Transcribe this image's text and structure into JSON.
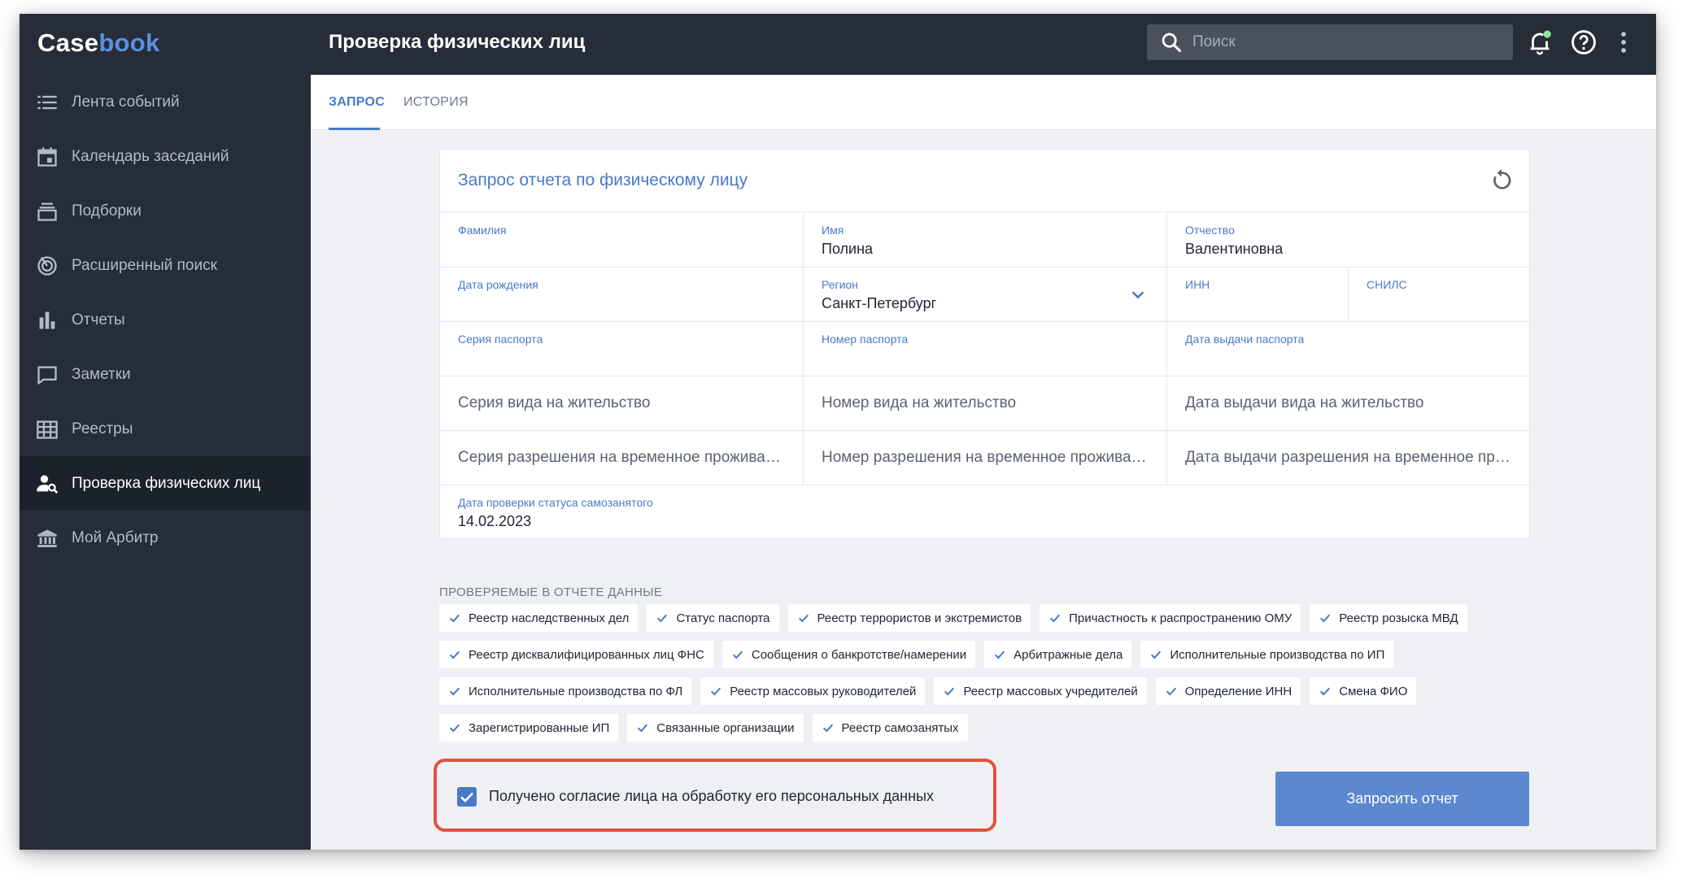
{
  "app": {
    "logo_part1": "Case",
    "logo_part2": "book",
    "page_title": "Проверка физических лиц"
  },
  "search": {
    "placeholder": "Поиск"
  },
  "sidebar": {
    "items": [
      {
        "label": "Лента событий",
        "icon": "list-icon"
      },
      {
        "label": "Календарь заседаний",
        "icon": "calendar-icon"
      },
      {
        "label": "Подборки",
        "icon": "stack-icon"
      },
      {
        "label": "Расширенный поиск",
        "icon": "target-icon"
      },
      {
        "label": "Отчеты",
        "icon": "bar-chart-icon"
      },
      {
        "label": "Заметки",
        "icon": "comment-icon"
      },
      {
        "label": "Реестры",
        "icon": "grid-icon"
      },
      {
        "label": "Проверка физических лиц",
        "icon": "person-search-icon",
        "active": true
      },
      {
        "label": "Мой Арбитр",
        "icon": "courthouse-icon"
      }
    ]
  },
  "tabs": [
    {
      "label": "ЗАПРОС",
      "active": true
    },
    {
      "label": "ИСТОРИЯ",
      "active": false
    }
  ],
  "form": {
    "title": "Запрос отчета по физическому лицу",
    "surname": {
      "label": "Фамилия",
      "value": ""
    },
    "name": {
      "label": "Имя",
      "value": "Полина"
    },
    "patronymic": {
      "label": "Отчество",
      "value": "Валентиновна"
    },
    "birth_date": {
      "label": "Дата рождения",
      "value": ""
    },
    "region": {
      "label": "Регион",
      "value": "Санкт-Петербург"
    },
    "inn": {
      "label": "ИНН",
      "value": ""
    },
    "snils": {
      "label": "СНИЛС",
      "value": ""
    },
    "passport_series": {
      "label": "Серия паспорта",
      "value": ""
    },
    "passport_number": {
      "label": "Номер паспорта",
      "value": ""
    },
    "passport_date": {
      "label": "Дата выдачи паспорта",
      "value": ""
    },
    "residence_series": {
      "placeholder": "Серия вида на жительство"
    },
    "residence_number": {
      "placeholder": "Номер вида на жительство"
    },
    "residence_date": {
      "placeholder": "Дата выдачи вида на жительство"
    },
    "temp_series": {
      "placeholder": "Серия разрешения на временное проживание"
    },
    "temp_number": {
      "placeholder": "Номер разрешения на временное проживание"
    },
    "temp_date": {
      "placeholder": "Дата выдачи разрешения на временное про..."
    },
    "self_employed": {
      "label": "Дата проверки статуса самозанятого",
      "value": "14.02.2023"
    }
  },
  "checked_data": {
    "label": "ПРОВЕРЯЕМЫЕ В ОТЧЕТЕ ДАННЫЕ",
    "rows": [
      [
        "Реестр наследственных дел",
        "Статус паспорта",
        "Реестр террористов и экстремистов",
        "Причастность к распространению ОМУ",
        "Реестр розыска МВД"
      ],
      [
        "Реестр дисквалифицированных лиц ФНС",
        "Сообщения о банкротстве/намерении",
        "Арбитражные дела",
        "Исполнительные производства по ИП"
      ],
      [
        "Исполнительные производства по ФЛ",
        "Реестр массовых руководителей",
        "Реестр массовых учредителей",
        "Определение ИНН",
        "Смена ФИО"
      ],
      [
        "Зарегистрированные ИП",
        "Связанные организации",
        "Реестр самозанятых"
      ]
    ]
  },
  "consent": {
    "label": "Получено согласие лица на обработку его персональных данных",
    "checked": true
  },
  "submit": {
    "label": "Запросить отчет"
  },
  "colors": {
    "accent": "#4a79c8",
    "sidebar_bg": "#262d38",
    "highlight": "#e0533a"
  }
}
